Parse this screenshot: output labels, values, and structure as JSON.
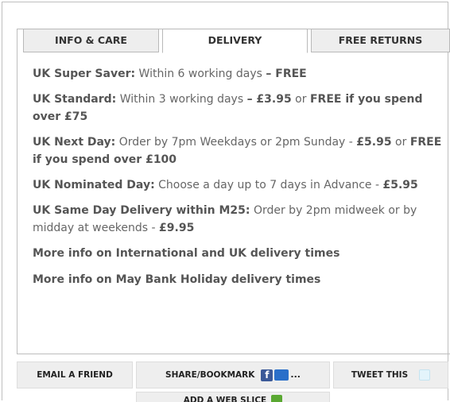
{
  "tabs": [
    {
      "label": "INFO & CARE",
      "active": false
    },
    {
      "label": "DELIVERY",
      "active": true
    },
    {
      "label": "FREE RETURNS",
      "active": false
    }
  ],
  "delivery": {
    "super_saver": {
      "name": "UK Super Saver:",
      "desc": " Within 6 working days ",
      "sep": "–",
      "price": " FREE"
    },
    "standard": {
      "name": "UK Standard:",
      "desc": " Within 3 working days ",
      "sep": "–",
      "price": " £3.95",
      "or": " or ",
      "free_if": "FREE if you spend over £75"
    },
    "next_day": {
      "name": "UK Next Day:",
      "desc": " Order by 7pm Weekdays or 2pm Sunday - ",
      "price": "£5.95",
      "or": " or ",
      "free_if": "FREE if you spend over £100"
    },
    "nominated_day": {
      "name": "UK Nominated Day:",
      "desc": " Choose a day up to 7 days in Advance - ",
      "price": "£5.95"
    },
    "same_day": {
      "name": "UK Same Day Delivery within M25:",
      "desc": " Order by 2pm midweek or by midday at weekends - ",
      "price": "£9.95"
    }
  },
  "links": {
    "international": "More info on International and UK delivery times",
    "bank_holiday": "More info on May Bank Holiday delivery times"
  },
  "actions": {
    "email_friend": "EMAIL A FRIEND",
    "share_bookmark": "SHARE/BOOKMARK",
    "share_ellipsis": "...",
    "tweet_this": "TWEET THIS",
    "web_slice": "ADD A WEB SLICE"
  },
  "icons": {
    "facebook": "facebook-icon",
    "social": "social-bookmark-icon",
    "twitter": "twitter-icon",
    "webslice": "webslice-icon"
  },
  "colors": {
    "tab_bg": "#eeeeee",
    "active_tab_bg": "#ffffff",
    "text": "#666666",
    "bold_text": "#555555",
    "button_bg": "#eeeeee",
    "facebook": "#3b5998"
  }
}
